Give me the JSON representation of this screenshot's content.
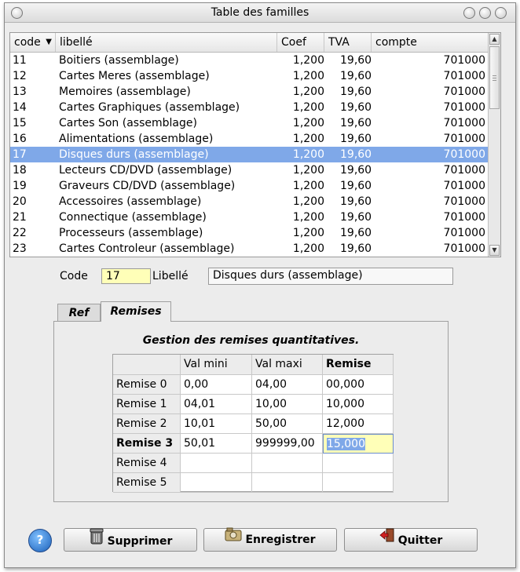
{
  "window": {
    "title": "Table des familles"
  },
  "list": {
    "columns": [
      "code",
      "libellé",
      "Coef",
      "TVA",
      "compte"
    ],
    "rows": [
      {
        "code": "11",
        "libelle": "Boitiers (assemblage)",
        "coef": "1,200",
        "tva": "19,60",
        "compte": "701000"
      },
      {
        "code": "12",
        "libelle": "Cartes Meres (assemblage)",
        "coef": "1,200",
        "tva": "19,60",
        "compte": "701000"
      },
      {
        "code": "13",
        "libelle": "Memoires (assemblage)",
        "coef": "1,200",
        "tva": "19,60",
        "compte": "701000"
      },
      {
        "code": "14",
        "libelle": "Cartes Graphiques (assemblage)",
        "coef": "1,200",
        "tva": "19,60",
        "compte": "701000"
      },
      {
        "code": "15",
        "libelle": "Cartes Son (assemblage)",
        "coef": "1,200",
        "tva": "19,60",
        "compte": "701000"
      },
      {
        "code": "16",
        "libelle": "Alimentations (assemblage)",
        "coef": "1,200",
        "tva": "19,60",
        "compte": "701000"
      },
      {
        "code": "17",
        "libelle": "Disques durs (assemblage)",
        "coef": "1,200",
        "tva": "19,60",
        "compte": "701000"
      },
      {
        "code": "18",
        "libelle": "Lecteurs CD/DVD (assemblage)",
        "coef": "1,200",
        "tva": "19,60",
        "compte": "701000"
      },
      {
        "code": "19",
        "libelle": "Graveurs CD/DVD (assemblage)",
        "coef": "1,200",
        "tva": "19,60",
        "compte": "701000"
      },
      {
        "code": "20",
        "libelle": "Accessoires (assemblage)",
        "coef": "1,200",
        "tva": "19,60",
        "compte": "701000"
      },
      {
        "code": "21",
        "libelle": "Connectique (assemblage)",
        "coef": "1,200",
        "tva": "19,60",
        "compte": "701000"
      },
      {
        "code": "22",
        "libelle": "Processeurs (assemblage)",
        "coef": "1,200",
        "tva": "19,60",
        "compte": "701000"
      },
      {
        "code": "23",
        "libelle": "Cartes Controleur (assemblage)",
        "coef": "1,200",
        "tva": "19,60",
        "compte": "701000"
      }
    ],
    "selected_index": 6
  },
  "form": {
    "code_label": "Code",
    "code_value": "17",
    "libelle_label": "Libellé",
    "libelle_value": "Disques durs (assemblage)"
  },
  "tabs": {
    "ref": "Ref",
    "remises": "Remises"
  },
  "remises": {
    "heading": "Gestion des remises quantitatives.",
    "col_headers": [
      "Val mini",
      "Val maxi",
      "Remise"
    ],
    "rows": [
      {
        "label": "Remise 0",
        "min": "0,00",
        "max": "04,00",
        "remise": "00,000"
      },
      {
        "label": "Remise 1",
        "min": "04,01",
        "max": "10,00",
        "remise": "10,000"
      },
      {
        "label": "Remise 2",
        "min": "10,01",
        "max": "50,00",
        "remise": "12,000"
      },
      {
        "label": "Remise 3",
        "min": "50,01",
        "max": "999999,00",
        "remise": "15,000"
      },
      {
        "label": "Remise 4",
        "min": "",
        "max": "",
        "remise": ""
      },
      {
        "label": "Remise 5",
        "min": "",
        "max": "",
        "remise": ""
      }
    ]
  },
  "buttons": {
    "supprimer": "Supprimer",
    "enregistrer": "Enregistrer",
    "quitter": "Quitter"
  },
  "colors": {
    "selection": "#7fa8e8",
    "edit_bg": "#ffffb8"
  }
}
